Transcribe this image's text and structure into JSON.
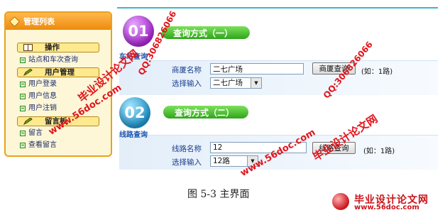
{
  "sidebar": {
    "title": "管理列表",
    "sections": [
      "操作",
      "用户管理",
      "留言板"
    ],
    "items": [
      "站点和车次查询",
      "用户登录",
      "用户信息",
      "用户注销",
      "留言",
      "查看留言"
    ]
  },
  "panel1": {
    "number": "01",
    "method": "查询方式（一）",
    "subtitle": "车站查询",
    "name_label": "商厦名称",
    "name_value": "二七广场",
    "button": "商厦查询",
    "hint": "(如：1路)",
    "select_label": "选择输入",
    "select_value": "二七广场"
  },
  "panel2": {
    "number": "02",
    "method": "查询方式（二）",
    "subtitle": "线路查询",
    "name_label": "线路名称",
    "name_value": "12",
    "button": "线路查询",
    "hint": "(如：1路)",
    "select_label": "选择输入",
    "select_value": "12路"
  },
  "caption": "图 5-3 主界面",
  "watermarks": [
    "毕业设计论文网",
    "www.56doc.com",
    "QQ:306826066"
  ],
  "logo": {
    "title": "毕业设计论文网",
    "url": "www.56doc.com"
  },
  "colors": {
    "sidebar_border": "#e9a21a",
    "badge1": "#a227c9",
    "badge2": "#1f8fc4",
    "pill": "#2fa51a",
    "watermark": "#e2141b"
  }
}
